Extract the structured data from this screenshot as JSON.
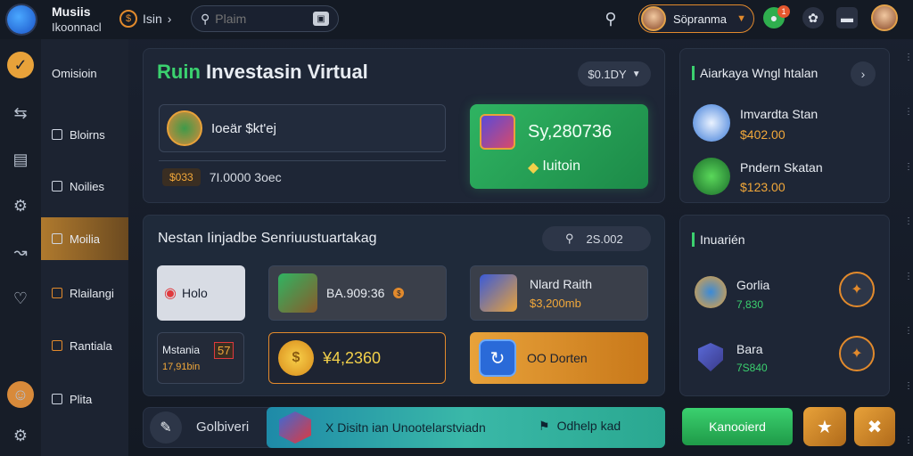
{
  "app": {
    "brand_line1": "Musiis",
    "brand_line2": "Ikoonnacl"
  },
  "topbar": {
    "breadcrumb_label": "Isin",
    "search_placeholder": "Plaim",
    "profile_name": "Söpranma",
    "badge_count": "1"
  },
  "sidebar": {
    "items": [
      {
        "label": "Omisioin",
        "icon": "home-icon"
      },
      {
        "label": "Bloirns",
        "icon": "grid-icon"
      },
      {
        "label": "Noilies",
        "icon": "folder-icon"
      },
      {
        "label": "Moilia",
        "icon": "media-icon"
      },
      {
        "label": "Rlailangi",
        "icon": "ranking-icon"
      },
      {
        "label": "Rantiala",
        "icon": "rank-icon"
      },
      {
        "label": "Plita",
        "icon": "plate-icon"
      }
    ]
  },
  "main": {
    "title_prefix": "Ruin",
    "title_rest": "Investasin Virtual",
    "dropdown_value": "$0.1DY",
    "account_card": {
      "label": "Ioeär $kt'ej"
    },
    "balance_row": {
      "tag": "$033",
      "text": "7I.0000 3oec"
    },
    "green_card": {
      "value": "Sy,280736",
      "sub": "Iuitoin"
    },
    "section2_title": "Nestan Iinjadbe Senriuustuartakag",
    "section2_pill": "2S.002",
    "tiles": [
      {
        "label": "Holo"
      },
      {
        "label": "BA.909:36"
      },
      {
        "label": "Nlard Raith",
        "sub": "$3,200mb"
      },
      {
        "label": "Mstania",
        "sub": "17,91bin",
        "tag": "57"
      },
      {
        "label": "¥4,2360"
      },
      {
        "label": "OO Dorten"
      }
    ]
  },
  "right": {
    "header": "Aiarkaya Wngl htalan",
    "list": [
      {
        "name": "Imvardta Stan",
        "amount": "$402.00"
      },
      {
        "name": "Pndern Skatan",
        "amount": "$123.00"
      }
    ],
    "section2_title": "Inuarién",
    "list2": [
      {
        "name": "Gorlia",
        "value": "7,830"
      },
      {
        "name": "Bara",
        "value": "7S840"
      }
    ]
  },
  "bottom": {
    "left_label": "Golbiveri",
    "banner_text": "X Disitn ian Unootelarstviadn",
    "banner_action": "Odhelp kad",
    "primary_button": "Kanooierd"
  },
  "colors": {
    "accent_orange": "#e28a2c",
    "accent_green": "#3bd16f",
    "panel": "#1e2636"
  }
}
